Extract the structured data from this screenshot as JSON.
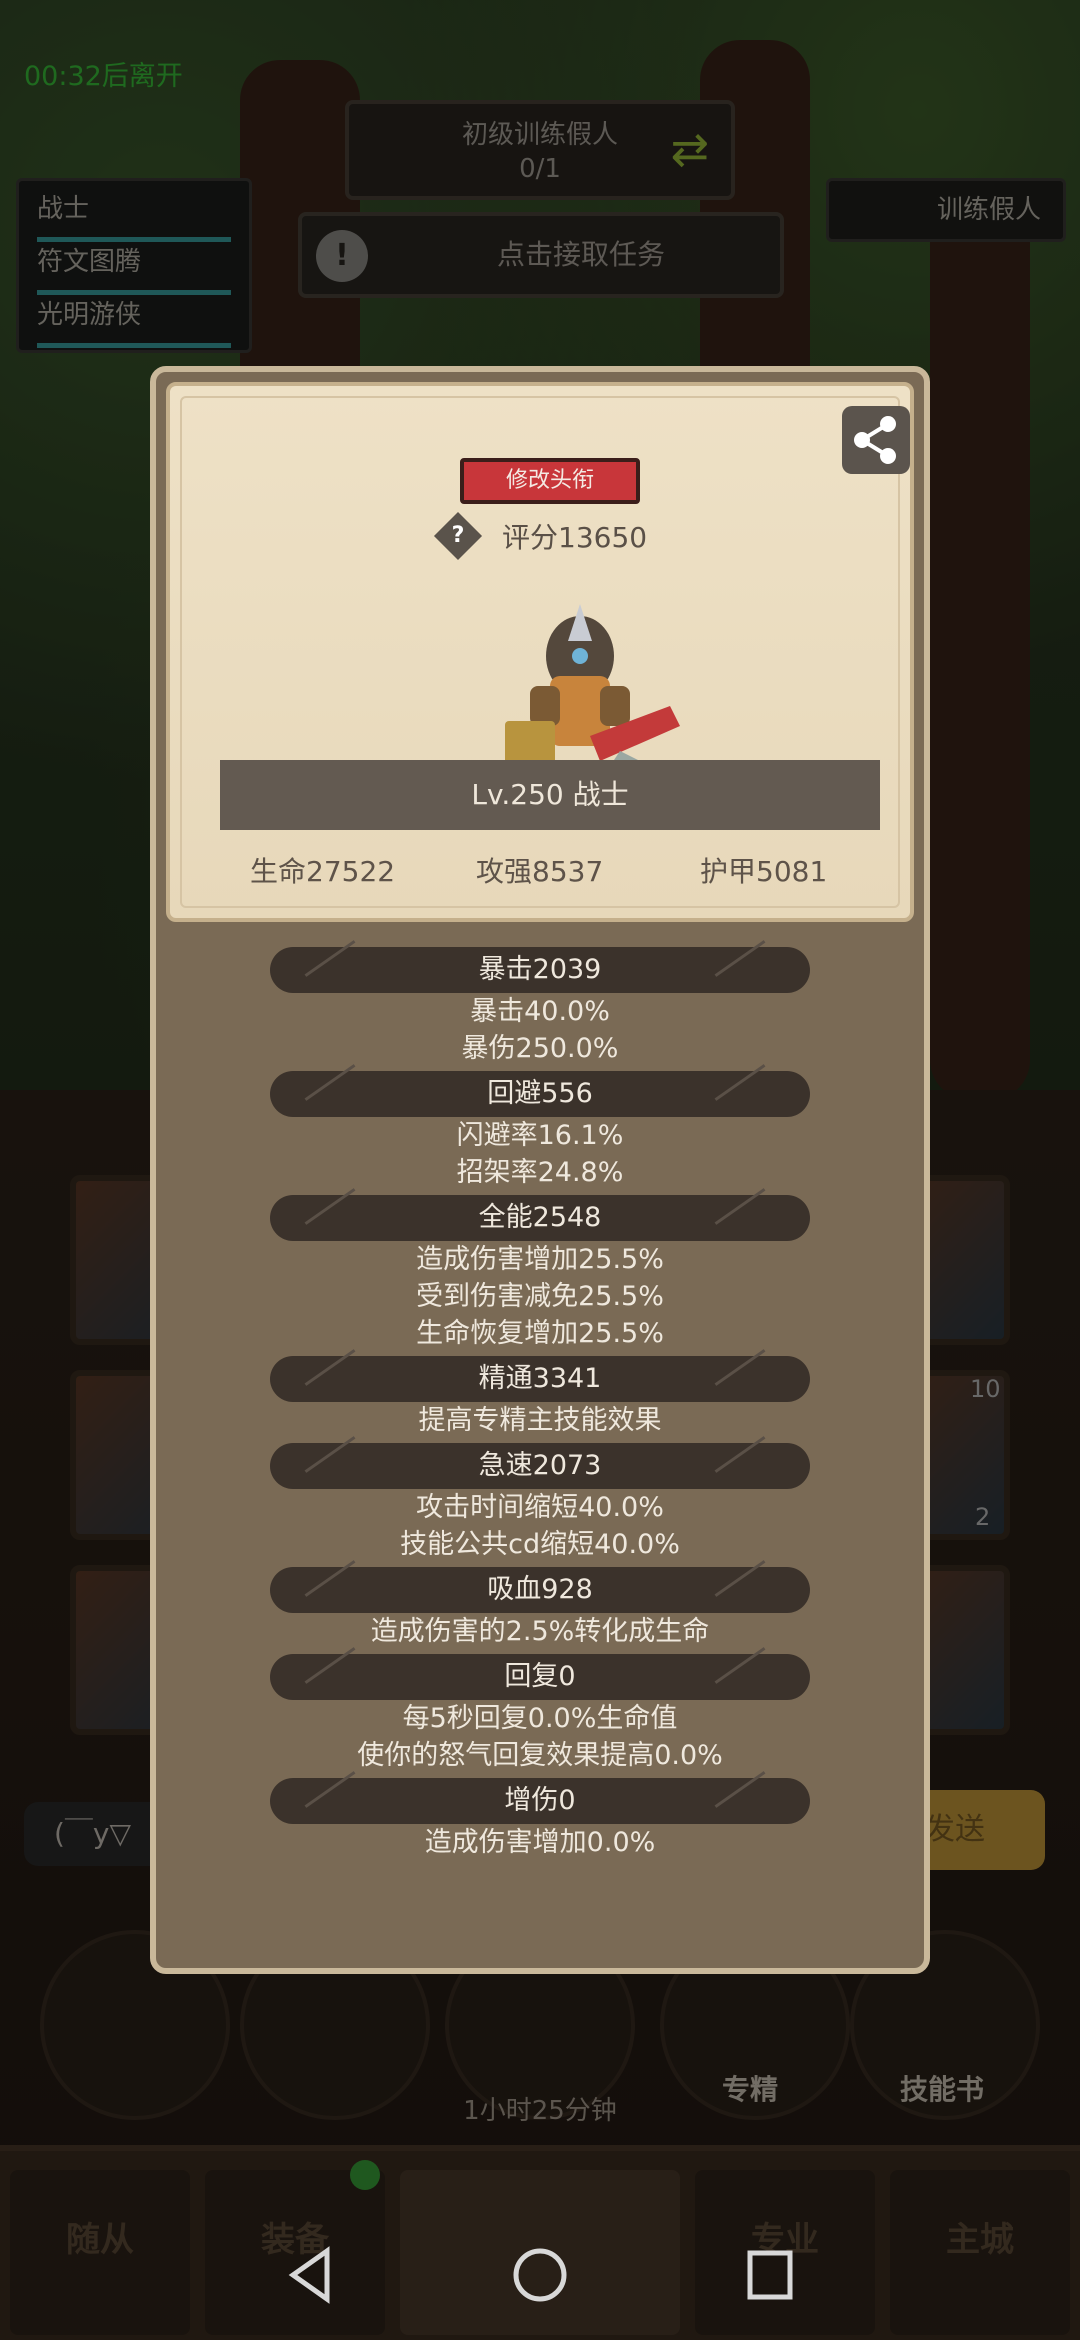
{
  "hud": {
    "timer": "00:32后离开",
    "task_title": "初级训练假人",
    "task_progress": "0/1",
    "accept_label": "点击接取任务",
    "target_label": "训练假人",
    "class_tabs": [
      "战士",
      "符文图腾",
      "光明游侠"
    ]
  },
  "chat": {
    "input_value": "(￣y▽",
    "send_label": "发送"
  },
  "bottom": {
    "timer": "1小时25分钟",
    "skill_labels": {
      "mastery": "专精",
      "skillbook": "技能书"
    },
    "badge_10": "10",
    "badge_2": "2",
    "nav_tabs": [
      "随从",
      "装备",
      "专业",
      "主城"
    ]
  },
  "profile": {
    "title_button": "修改头衔",
    "score": "评分13650",
    "level_class": "Lv.250 战士",
    "hp": "生命27522",
    "attack": "攻强8537",
    "armor": "护甲5081"
  },
  "stats": [
    {
      "header": "暴击2039",
      "lines": [
        "暴击40.0%",
        "暴伤250.0%"
      ]
    },
    {
      "header": "回避556",
      "lines": [
        "闪避率16.1%",
        "招架率24.8%"
      ]
    },
    {
      "header": "全能2548",
      "lines": [
        "造成伤害增加25.5%",
        "受到伤害减免25.5%",
        "生命恢复增加25.5%"
      ]
    },
    {
      "header": "精通3341",
      "lines": [
        "提高专精主技能效果"
      ]
    },
    {
      "header": "急速2073",
      "lines": [
        "攻击时间缩短40.0%",
        "技能公共cd缩短40.0%"
      ]
    },
    {
      "header": "吸血928",
      "lines": [
        "造成伤害的2.5%转化成生命"
      ]
    },
    {
      "header": "回复0",
      "lines": [
        "每5秒回复0.0%生命值",
        "使你的怒气回复效果提高0.0%"
      ]
    },
    {
      "header": "增伤0",
      "lines": [
        "造成伤害增加0.0%"
      ]
    }
  ]
}
